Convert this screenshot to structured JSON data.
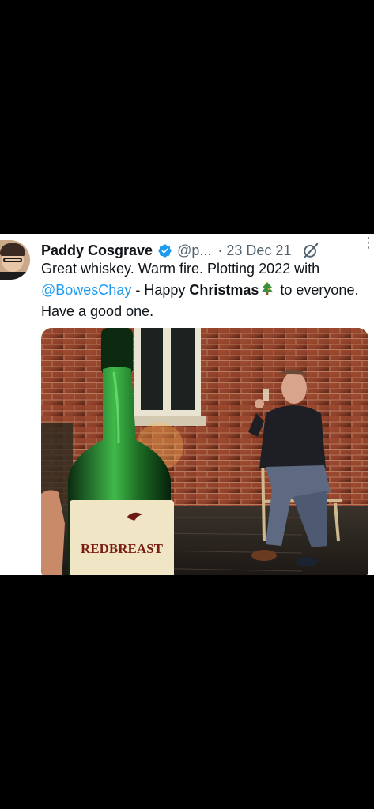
{
  "tweet": {
    "author_name": "Paddy Cosgrave",
    "handle": "@p...",
    "date": "· 23 Dec 21",
    "text_part1": "Great whiskey. Warm fire. Plotting 2022 with ",
    "mention": "@BowesChay",
    "text_part2": " - Happy ",
    "text_bold": "Christmas",
    "text_part3": " to everyone. Have a good one.",
    "more_glyph": "⋮",
    "image_label": "REDBREAST"
  },
  "icons": {
    "verified": "verified-badge-icon",
    "grok": "grok-icon",
    "more": "more-options-icon",
    "emoji": "christmas-tree-emoji"
  },
  "colors": {
    "verified_blue": "#1d9bf0",
    "mention_blue": "#1d9bf0",
    "muted_gray": "#536471"
  }
}
